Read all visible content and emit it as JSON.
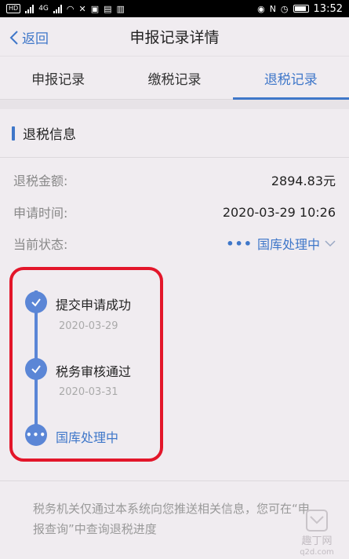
{
  "statusbar": {
    "time": "13:52",
    "left_chip": "HD",
    "net": "4G"
  },
  "nav": {
    "back_label": "返回",
    "title": "申报记录详情"
  },
  "tabs": [
    "申报记录",
    "缴税记录",
    "退税记录"
  ],
  "active_tab": 2,
  "section": {
    "title": "退税信息"
  },
  "info": {
    "amount_label": "退税金额:",
    "amount_value": "2894.83元",
    "time_label": "申请时间:",
    "time_value": "2020-03-29 10:26",
    "status_label": "当前状态:",
    "status_value": "国库处理中",
    "status_dots": "•••"
  },
  "timeline": [
    {
      "title": "提交申请成功",
      "date": "2020-03-29",
      "icon": "check-icon"
    },
    {
      "title": "税务审核通过",
      "date": "2020-03-31",
      "icon": "check-icon"
    },
    {
      "title": "国库处理中",
      "date": "",
      "icon": "ellipsis-icon"
    }
  ],
  "note": "税务机关仅通过本系统向您推送相关信息，您可在“申报查询”中查询退税进度",
  "watermark": {
    "text": "趣丁网",
    "url": "q2d.com"
  },
  "colors": {
    "accent": "#3f77c9",
    "highlight": "#e3162a",
    "node": "#5b86d6",
    "background": "#f0ecf0"
  }
}
